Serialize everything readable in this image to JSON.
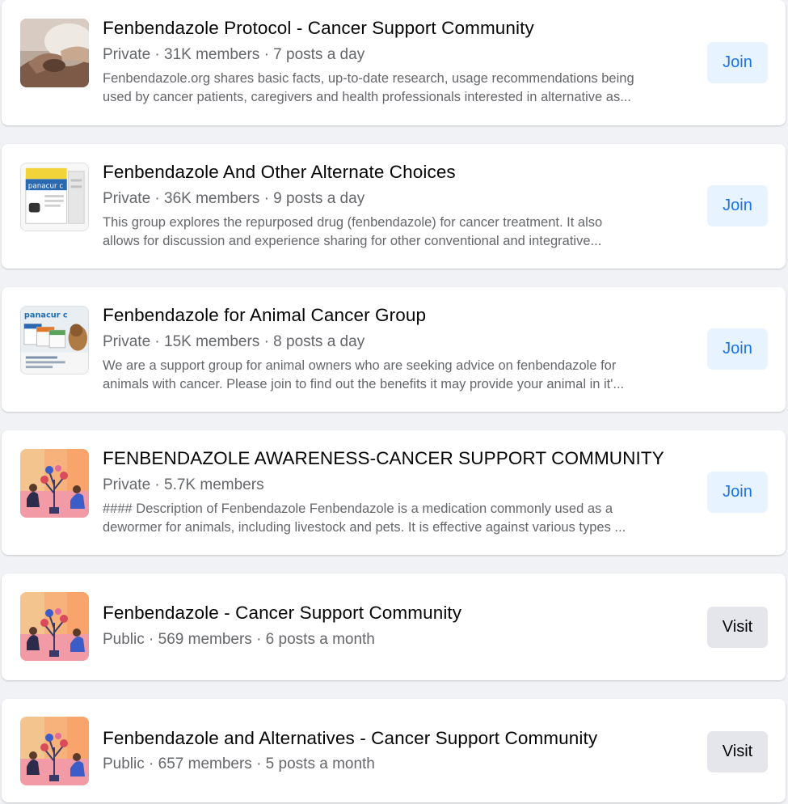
{
  "groups": [
    {
      "name": "Fenbendazole Protocol - Cancer Support Community",
      "meta": "Private · 31K members · 7 posts a day",
      "desc_line1": "Fenbendazole.org shares basic facts, up-to-date research, usage recommendations being",
      "desc_line2": "used by cancer patients, caregivers and health professionals interested in alternative as...",
      "action": "Join"
    },
    {
      "name": "Fenbendazole And Other Alternate Choices",
      "meta": "Private · 36K members · 9 posts a day",
      "desc_line1": "This group explores the repurposed drug (fenbendazole) for cancer treatment. It also",
      "desc_line2": "allows for discussion and experience sharing for other conventional and integrative...",
      "action": "Join"
    },
    {
      "name": "Fenbendazole for Animal Cancer Group",
      "meta": "Private · 15K members · 8 posts a day",
      "desc_line1": "We are a support group for animal owners who are seeking advice on fenbendazole for",
      "desc_line2": "animals with cancer. Please join to find out the benefits it may provide your animal in it'...",
      "action": "Join"
    },
    {
      "name": "FENBENDAZOLE AWARENESS-CANCER SUPPORT COMMUNITY",
      "meta": "Private · 5.7K members",
      "desc_line1": "#### Description of Fenbendazole Fenbendazole is a medication commonly used as a",
      "desc_line2": "dewormer for animals, including livestock and pets. It is effective against various types ...",
      "action": "Join"
    },
    {
      "name": "Fenbendazole - Cancer Support Community",
      "meta": "Public · 569 members · 6 posts a month",
      "action": "Visit"
    },
    {
      "name": "Fenbendazole and Alternatives - Cancer Support Community",
      "meta": "Public · 657 members · 5 posts a month",
      "action": "Visit"
    }
  ],
  "thumb_text": {
    "panacur_box": "panacur c",
    "panacur_animal": "panacur c"
  },
  "colors": {
    "join_bg": "#e7f3ff",
    "join_text": "#1b74e4",
    "visit_bg": "#e4e6eb",
    "page_bg": "#f0f2f5"
  }
}
